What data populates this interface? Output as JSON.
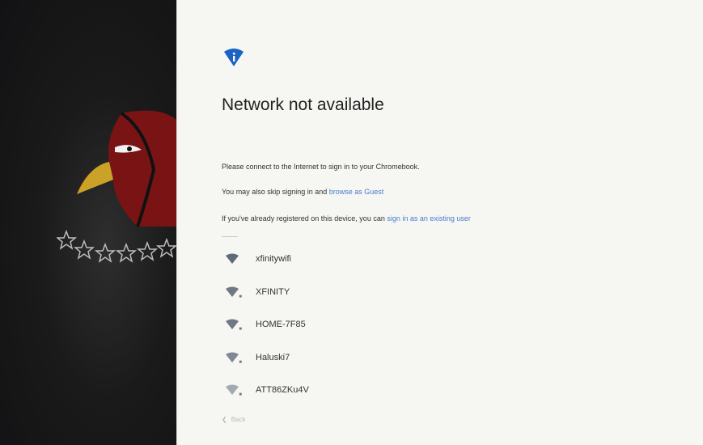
{
  "dialog": {
    "title": "Network not available",
    "message_1": "Please connect to the Internet to sign in to your Chromebook.",
    "message_2_prefix": "You may also skip signing in and ",
    "message_2_link": "browse as Guest",
    "message_3_prefix": "If you've already registered on this device, you can ",
    "message_3_link": "sign in as an existing user",
    "back_label": "Back"
  },
  "networks": [
    {
      "name": "xfinitywifi",
      "icon": "wifi-icon",
      "secured": false
    },
    {
      "name": "XFINITY",
      "icon": "wifi-secured-icon",
      "secured": true
    },
    {
      "name": "HOME-7F85",
      "icon": "wifi-secured-icon",
      "secured": true
    },
    {
      "name": "Haluski7",
      "icon": "wifi-secured-icon",
      "secured": true
    },
    {
      "name": "ATT86ZKu4V",
      "icon": "wifi-secured-icon",
      "secured": true
    }
  ],
  "colors": {
    "accent": "#1a62c4",
    "link": "#4a7bd1",
    "wallpaper": "#1a1a1a"
  }
}
